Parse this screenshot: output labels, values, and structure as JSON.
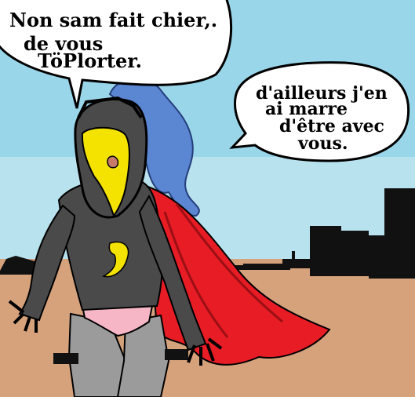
{
  "speech_bubbles": {
    "left": {
      "lines": [
        "Non sam fait chier,.",
        "de vous",
        "TöPlorter."
      ]
    },
    "right": {
      "lines": [
        "d'ailleurs j'en",
        "ai marre",
        "d'être avec",
        "vous."
      ]
    }
  },
  "colors": {
    "sky": "#9ad6ea",
    "ground": "#d5a27c",
    "armor": "#4a4a4a",
    "mask": "#f4e300",
    "cape": "#e81c24",
    "hair": "#5b86d2",
    "legs": "#9b9b9b",
    "underwear": "#f6b6c6",
    "silhouette": "#111111"
  }
}
